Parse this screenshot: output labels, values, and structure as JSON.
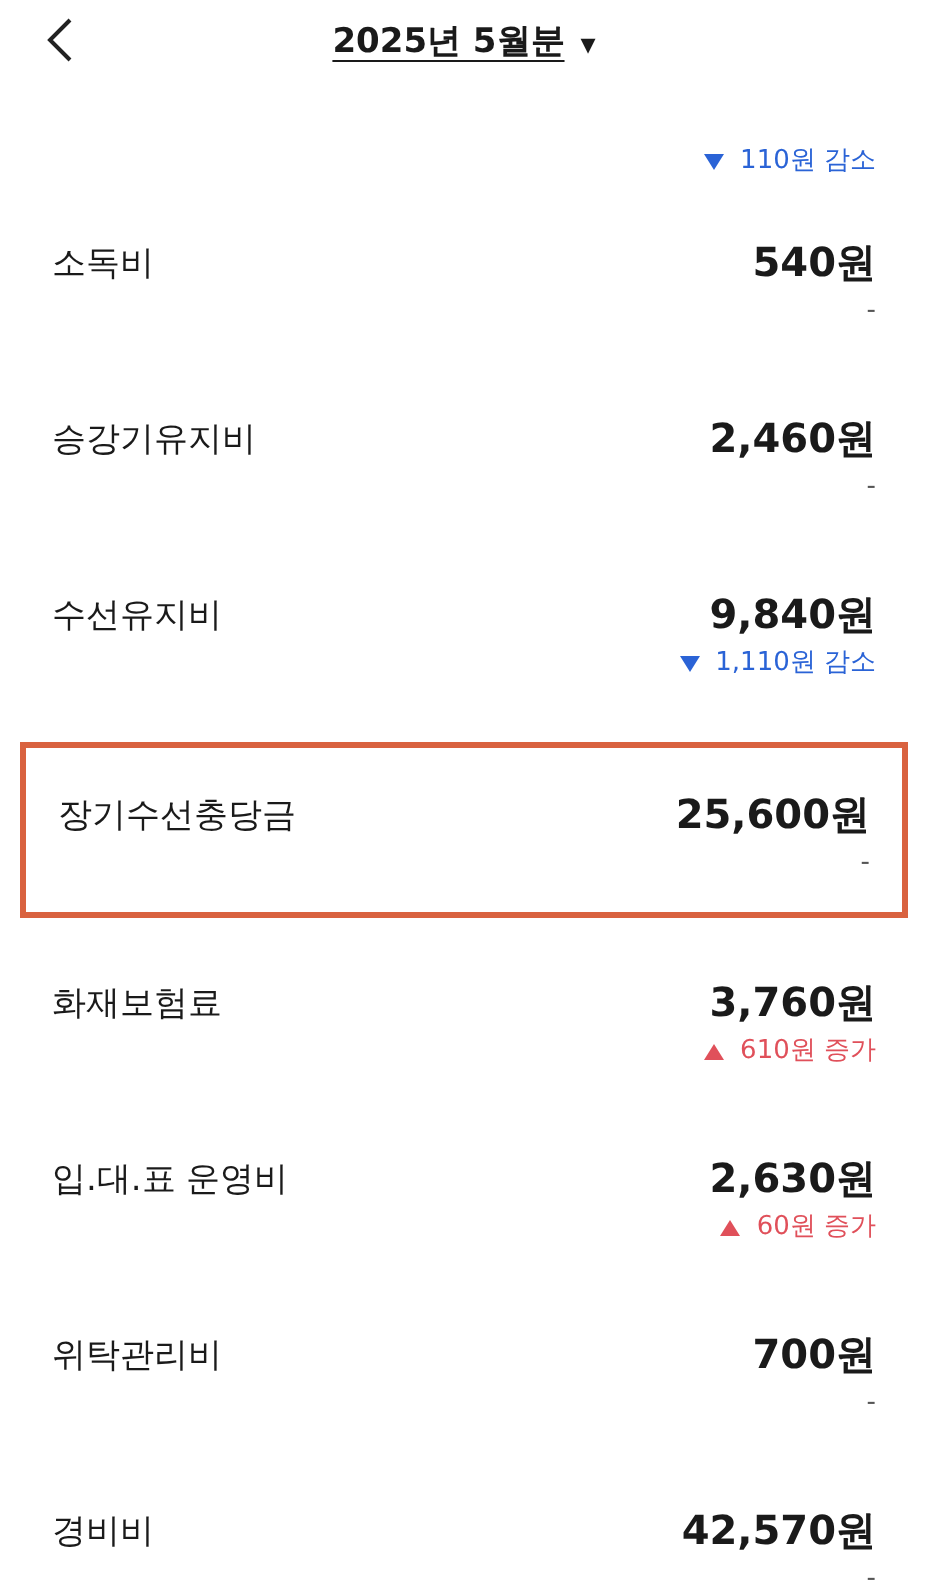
{
  "header": {
    "title": "2025년 5월분",
    "dropdown": "▾"
  },
  "partial_row": {
    "change": {
      "kind": "decrease",
      "text": "110원 감소"
    }
  },
  "rows": [
    {
      "label": "소독비",
      "amount": "540원",
      "highlighted": false,
      "change": {
        "kind": "none",
        "text": "-"
      }
    },
    {
      "label": "승강기유지비",
      "amount": "2,460원",
      "highlighted": false,
      "change": {
        "kind": "none",
        "text": "-"
      }
    },
    {
      "label": "수선유지비",
      "amount": "9,840원",
      "highlighted": false,
      "change": {
        "kind": "decrease",
        "text": "1,110원 감소"
      }
    },
    {
      "label": "장기수선충당금",
      "amount": "25,600원",
      "highlighted": true,
      "change": {
        "kind": "none",
        "text": "-"
      }
    },
    {
      "label": "화재보험료",
      "amount": "3,760원",
      "highlighted": false,
      "change": {
        "kind": "increase",
        "text": "610원 증가"
      }
    },
    {
      "label": "입.대.표 운영비",
      "amount": "2,630원",
      "highlighted": false,
      "change": {
        "kind": "increase",
        "text": "60원 증가"
      }
    },
    {
      "label": "위탁관리비",
      "amount": "700원",
      "highlighted": false,
      "change": {
        "kind": "none",
        "text": "-"
      }
    },
    {
      "label": "경비비",
      "amount": "42,570원",
      "highlighted": false,
      "change": {
        "kind": "none",
        "text": "-"
      }
    }
  ]
}
